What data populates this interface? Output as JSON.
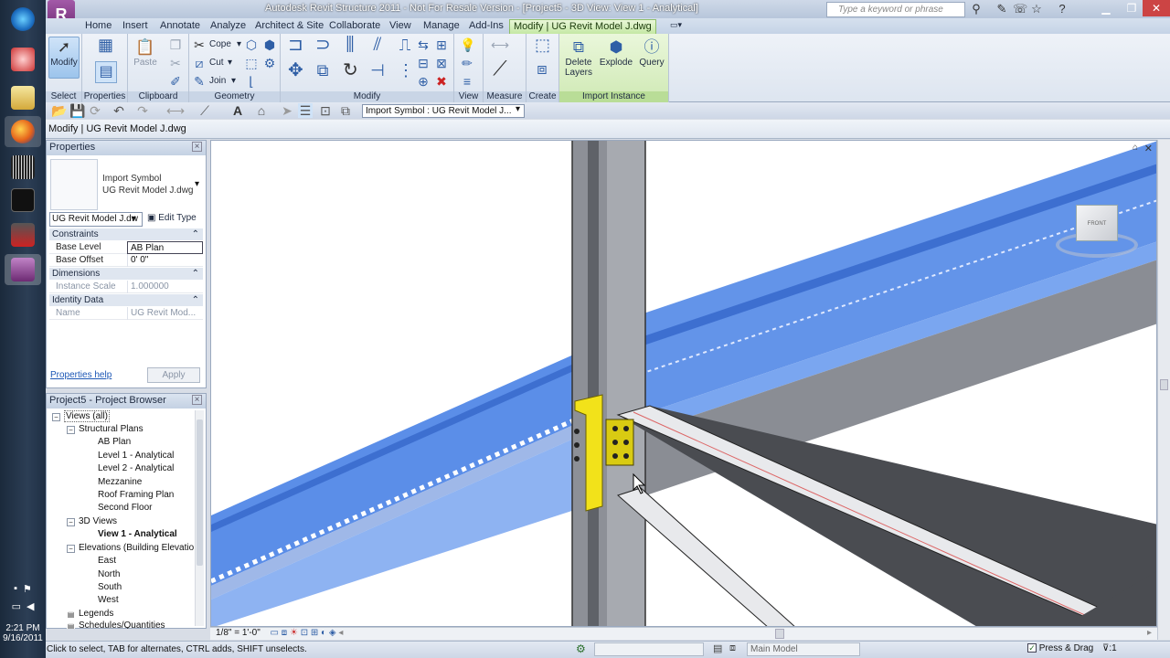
{
  "titlebar": {
    "title": "Autodesk Revit Structure 2011 - Not For Resale Version - [Project5 - 3D View: View 1 - Analytical]",
    "search_placeholder": "Type a keyword or phrase"
  },
  "tabs": [
    "Home",
    "Insert",
    "Annotate",
    "Analyze",
    "Architect & Site",
    "Collaborate",
    "View",
    "Manage",
    "Add-Ins",
    "Modify | UG Revit Model J.dwg"
  ],
  "ribbon": {
    "select": {
      "button": "Modify",
      "label": "Select"
    },
    "properties": {
      "label": "Properties"
    },
    "clipboard": {
      "paste": "Paste",
      "label": "Clipboard"
    },
    "geometry": {
      "cope": "Cope",
      "cut": "Cut",
      "join": "Join",
      "label": "Geometry"
    },
    "modify": {
      "label": "Modify"
    },
    "view": {
      "label": "View"
    },
    "measure": {
      "label": "Measure"
    },
    "create": {
      "label": "Create"
    },
    "import_instance": {
      "delete_layers": "Delete Layers",
      "explode": "Explode",
      "query": "Query",
      "label": "Import Instance"
    }
  },
  "optbar": {
    "type_select": "Import Symbol : UG Revit Model J..."
  },
  "ctxbar": {
    "text": "Modify | UG Revit Model J.dwg"
  },
  "properties": {
    "title": "Properties",
    "type_line1": "Import Symbol",
    "type_line2": "UG Revit Model J.dwg",
    "instance_select": "UG Revit Model J.dw",
    "edit_type": "Edit Type",
    "groups": {
      "constraints": "Constraints",
      "dimensions": "Dimensions",
      "identity": "Identity Data"
    },
    "rows": {
      "base_level_k": "Base Level",
      "base_level_v": "AB Plan",
      "base_offset_k": "Base Offset",
      "base_offset_v": "0'  0\"",
      "instance_scale_k": "Instance Scale",
      "instance_scale_v": "1.000000",
      "name_k": "Name",
      "name_v": "UG Revit Mod..."
    },
    "help": "Properties help",
    "apply": "Apply"
  },
  "browser": {
    "title": "Project5 - Project Browser",
    "items": {
      "views_all": "Views (all)",
      "structural_plans": "Structural Plans",
      "ab_plan": "AB Plan",
      "level1": "Level 1 - Analytical",
      "level2": "Level 2 - Analytical",
      "mezzanine": "Mezzanine",
      "roof": "Roof Framing Plan",
      "second": "Second Floor",
      "views_3d": "3D Views",
      "view1": "View 1 - Analytical",
      "elevations": "Elevations (Building Elevatio",
      "east": "East",
      "north": "North",
      "south": "South",
      "west": "West",
      "legends": "Legends",
      "schedules": "Schedules/Quantities"
    }
  },
  "view_ctrl": {
    "scale": "1/8\" = 1'-0\""
  },
  "statusbar": {
    "text": "Click to select, TAB for alternates, CTRL adds, SHIFT unselects.",
    "model": "Main Model",
    "press_drag": "Press & Drag",
    "filter_count": ":1"
  },
  "tray": {
    "time": "2:21 PM",
    "date": "9/16/2011"
  },
  "viewcube": {
    "top": "TOP",
    "front": "FRONT",
    "right": "RIGHT"
  },
  "colors": {
    "beam_blue": "#5b8ee8",
    "ribbon_green": "#c4e8a4",
    "connection_yellow": "#f2e21a"
  }
}
